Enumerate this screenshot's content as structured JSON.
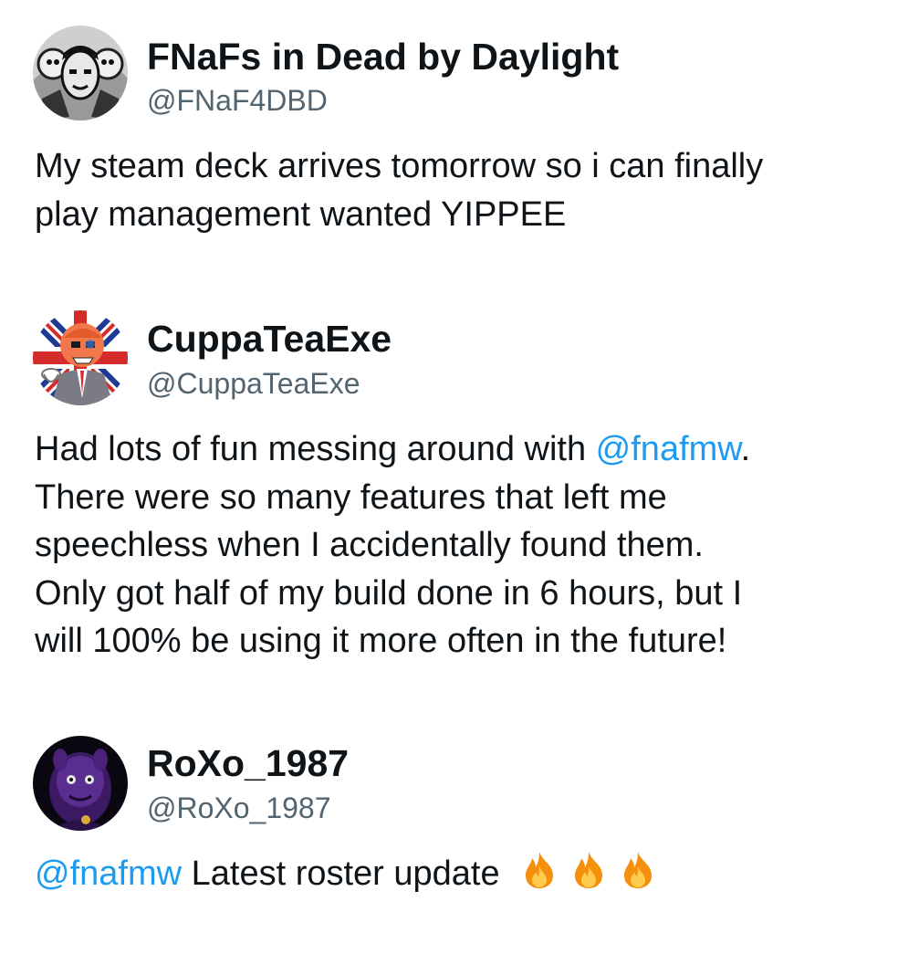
{
  "tweets": [
    {
      "display_name": "FNaFs in Dead by Daylight",
      "handle": "@FNaF4DBD",
      "avatar": "fnaf-dbd-avatar",
      "lines": [
        "My steam deck arrives tomorrow so i can finally",
        "play management wanted YIPPEE"
      ]
    },
    {
      "display_name": "CuppaTeaExe",
      "handle": "@CuppaTeaExe",
      "avatar": "cuppateaexe-avatar",
      "line1_before": "Had lots of fun messing around with ",
      "line1_mention": "@fnafmw",
      "line1_after": ".",
      "lines": [
        "There were so many features that left me",
        "speechless when I accidentally found them.",
        "Only got half of my build done in 6 hours, but I",
        "will 100% be using it more often in the future!"
      ]
    },
    {
      "display_name": "RoXo_1987",
      "handle": "@RoXo_1987",
      "avatar": "roxo-avatar",
      "mention": "@fnafmw",
      "text": " Latest roster update",
      "emoji": [
        "fire-icon",
        "fire-icon",
        "fire-icon"
      ]
    }
  ],
  "colors": {
    "text": "#0f1419",
    "handle": "#536471",
    "mention": "#1d9bf0"
  }
}
